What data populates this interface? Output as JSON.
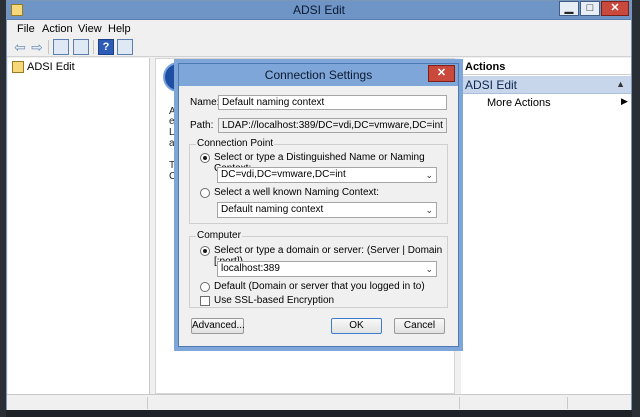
{
  "window": {
    "title": "ADSI Edit",
    "minimize_symbol": "▁",
    "maximize_symbol": "□",
    "close_symbol": "✕"
  },
  "menu": {
    "items": [
      "File",
      "Action",
      "View",
      "Help"
    ]
  },
  "toolbar": {
    "back_icon": "back-arrow-icon",
    "forward_icon": "forward-arrow-icon",
    "back_symbol": "⇦",
    "forward_symbol": "⇨",
    "help_symbol": "?"
  },
  "tree": {
    "root_label": "ADSI Edit"
  },
  "center": {
    "fragments": [
      "Ac",
      "edi",
      "Lig",
      "and",
      "To",
      "Co"
    ]
  },
  "actions": {
    "header": "Actions",
    "section_title": "ADSI Edit",
    "section_symbol": "▲",
    "more_actions_label": "More Actions",
    "more_actions_symbol": "▶"
  },
  "dialog": {
    "title": "Connection Settings",
    "close_symbol": "✕",
    "name_label": "Name:",
    "name_value": "Default naming context",
    "path_label": "Path:",
    "path_value": "LDAP://localhost:389/DC=vdi,DC=vmware,DC=int",
    "connection_point_legend": "Connection Point",
    "dn_radio_label": "Select or type a Distinguished Name or Naming Context:",
    "dn_value": "DC=vdi,DC=vmware,DC=int",
    "wkn_radio_label": "Select a well known Naming Context:",
    "wkn_value": "Default naming context",
    "computer_legend": "Computer",
    "server_radio_label": "Select or type a domain or server: (Server | Domain [:port])",
    "server_value": "localhost:389",
    "default_radio_label": "Default (Domain or server that you logged in to)",
    "ssl_checkbox_label": "Use SSL-based Encryption",
    "caret_symbol": "⌄",
    "advanced_button": "Advanced...",
    "ok_button": "OK",
    "cancel_button": "Cancel"
  },
  "colors": {
    "titlebar": "#6e95c6",
    "dialog_frame": "#7fa6d8",
    "close_button": "#c94a3d",
    "actions_section": "#c7d6ea"
  }
}
